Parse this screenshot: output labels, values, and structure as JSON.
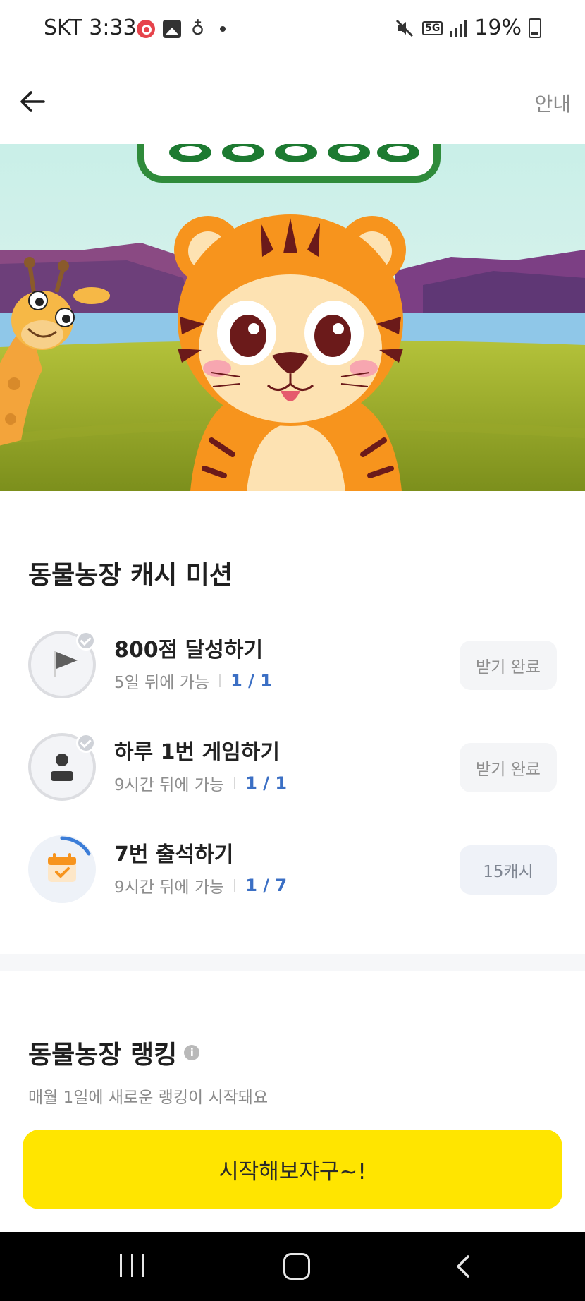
{
  "status_bar": {
    "carrier_time": "SKT 3:33",
    "network": "5G",
    "battery": "19%"
  },
  "header": {
    "guide_label": "안내"
  },
  "missions_section": {
    "title": "동물농장 캐시 미션",
    "items": [
      {
        "title": "800점 달성하기",
        "availability": "5일 뒤에 가능",
        "progress": "1 / 1",
        "button_label": "받기 완료",
        "icon": "flag-icon"
      },
      {
        "title": "하루 1번 게임하기",
        "availability": "9시간 뒤에 가능",
        "progress": "1 / 1",
        "button_label": "받기 완료",
        "icon": "person-icon"
      },
      {
        "title": "7번 출석하기",
        "availability": "9시간 뒤에 가능",
        "progress": "1 / 7",
        "button_label": "15캐시",
        "icon": "calendar-icon"
      }
    ]
  },
  "ranking_section": {
    "title": "동물농장 랭킹",
    "subtitle": "매월 1일에 새로운 랭킹이 시작돼요"
  },
  "cta_label": "시작해보쟈구~!",
  "colors": {
    "cta": "#ffe500",
    "progress_text": "#3b6fc4",
    "accent_tiger": "#f7941d"
  }
}
